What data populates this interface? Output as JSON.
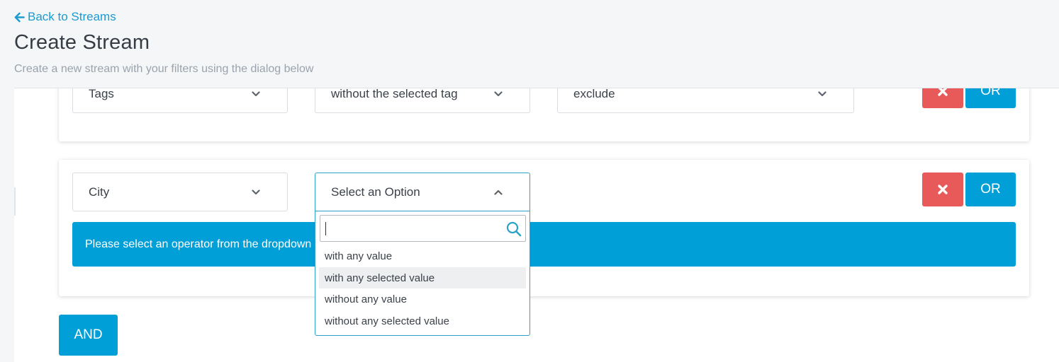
{
  "header": {
    "back_label": "Back to Streams",
    "title": "Create Stream",
    "subtitle": "Create a new stream with your filters using the dialog below"
  },
  "filters": [
    {
      "field": "Tags",
      "operator": "without the selected tag",
      "value": "exclude",
      "or_label": "OR"
    },
    {
      "field": "City",
      "operator": "Select an Option",
      "or_label": "OR",
      "info": "Please select an operator from the dropdown"
    }
  ],
  "dropdown": {
    "search_value": "",
    "options": [
      "with any value",
      "with any selected value",
      "without any value",
      "without any selected value"
    ],
    "highlighted_index": 1
  },
  "and_label": "AND",
  "colors": {
    "accent": "#019fd8",
    "danger": "#e85a5a",
    "link": "#1b9bd1"
  }
}
